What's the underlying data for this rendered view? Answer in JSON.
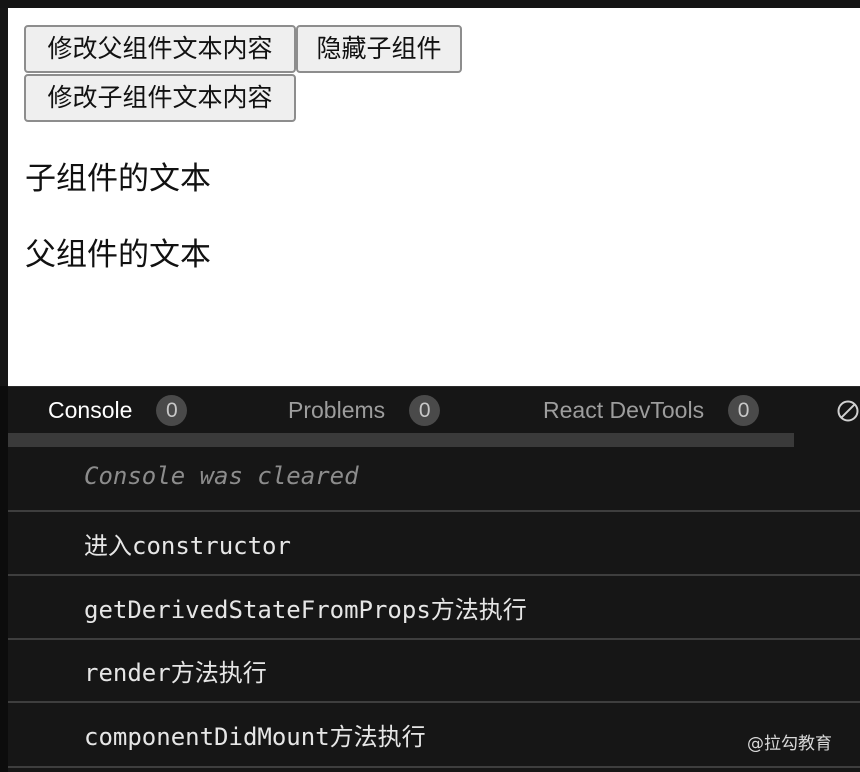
{
  "preview": {
    "buttons": {
      "modify_parent_text": "修改父组件文本内容",
      "hide_child": "隐藏子组件",
      "modify_child_text": "修改子组件文本内容"
    },
    "child_text": "子组件的文本",
    "parent_text": "父组件的文本"
  },
  "devtools": {
    "tabs": [
      {
        "label": "Console",
        "count": "0"
      },
      {
        "label": "Problems",
        "count": "0"
      },
      {
        "label": "React DevTools",
        "count": "0"
      }
    ],
    "clear_icon": "clear-console-icon"
  },
  "console": {
    "cleared_message": "Console was cleared",
    "logs": [
      "进入constructor",
      "getDerivedStateFromProps方法执行",
      "render方法执行",
      "componentDidMount方法执行"
    ]
  },
  "watermark": "@拉勾教育",
  "colors": {
    "preview_bg": "#ffffff",
    "panel_bg": "#161616",
    "active_tab": "#ffffff",
    "inactive_tab": "#9d9d9d",
    "badge_bg": "#4a4a4a"
  }
}
